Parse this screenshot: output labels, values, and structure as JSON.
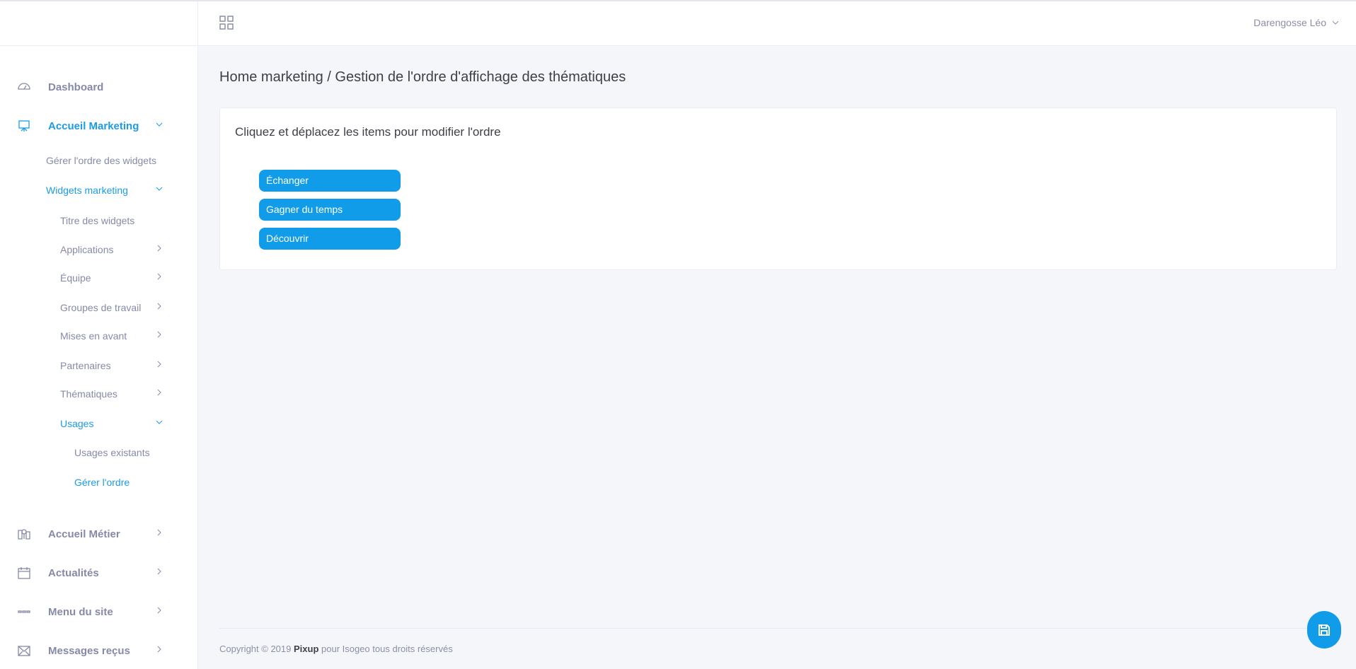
{
  "header": {
    "user_name": "Darengosse Léo",
    "menu_icon": "grid-icon"
  },
  "sidebar": {
    "items": [
      {
        "label": "Dashboard",
        "icon": "gauge-icon"
      },
      {
        "label": "Accueil Marketing",
        "icon": "presentation-icon"
      },
      {
        "label": "Gérer l'ordre des widgets"
      },
      {
        "label": "Widgets marketing"
      },
      {
        "label": "Titre des widgets"
      },
      {
        "label": "Applications"
      },
      {
        "label": "Équipe"
      },
      {
        "label": "Groupes de travail"
      },
      {
        "label": "Mises en avant"
      },
      {
        "label": "Partenaires"
      },
      {
        "label": "Thématiques"
      },
      {
        "label": "Usages"
      },
      {
        "label": "Usages existants"
      },
      {
        "label": "Gérer l'ordre"
      },
      {
        "label": "Accueil Métier",
        "icon": "map-pin-icon"
      },
      {
        "label": "Actualités",
        "icon": "calendar-icon"
      },
      {
        "label": "Menu du site",
        "icon": "menu-dots-icon"
      },
      {
        "label": "Messages reçus",
        "icon": "envelope-icon"
      }
    ]
  },
  "breadcrumb": "Home marketing / Gestion de l'ordre d'affichage des thématiques",
  "card": {
    "instruction": "Cliquez et déplacez les items pour modifier l'ordre",
    "items": [
      "Échanger",
      "Gagner du temps",
      "Découvrir"
    ]
  },
  "footer": {
    "prefix": "Copyright © 2019 ",
    "brand": "Pixup",
    "suffix": " pour Isogeo tous droits réservés"
  },
  "colors": {
    "accent": "#119ce9",
    "text_muted": "#868aa8"
  }
}
